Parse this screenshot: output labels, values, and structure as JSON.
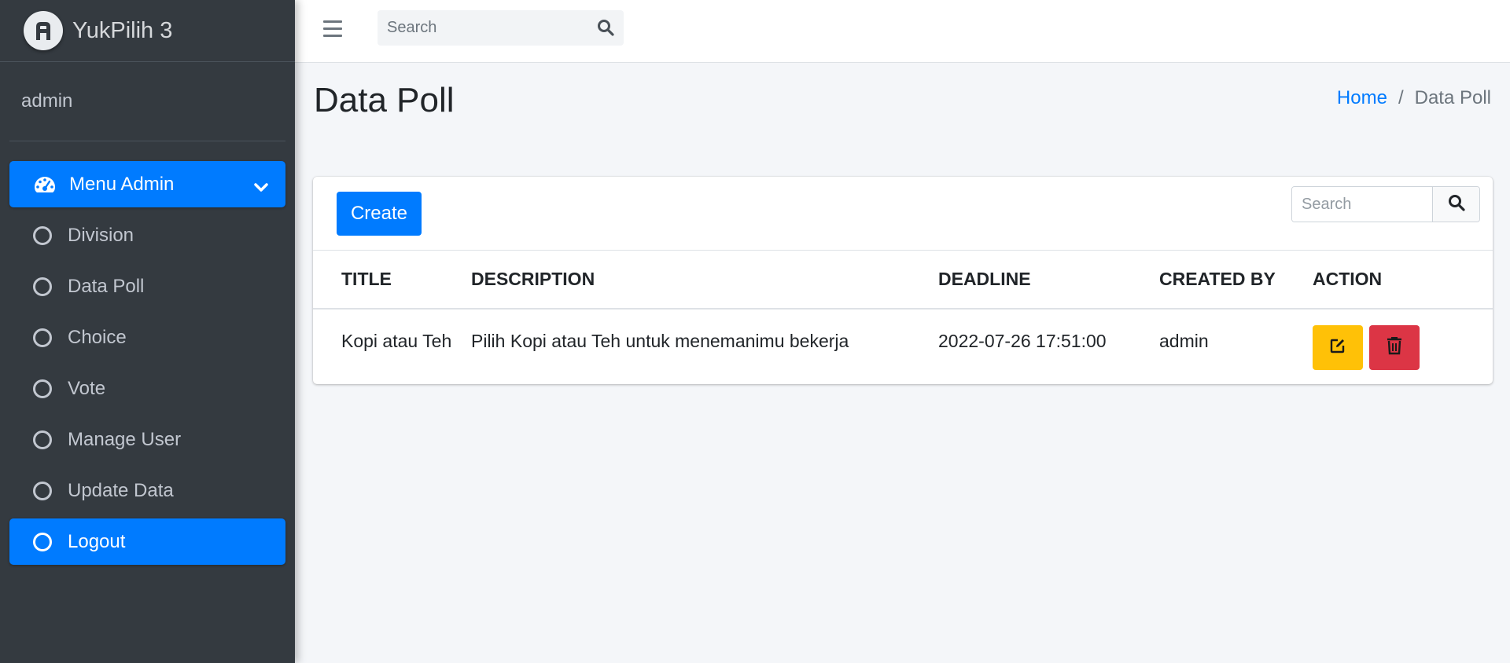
{
  "brand": {
    "name": "YukPilih 3"
  },
  "user": {
    "name": "admin"
  },
  "sidebar": {
    "menu_header": "Menu Admin",
    "items": [
      {
        "label": "Division"
      },
      {
        "label": "Data Poll"
      },
      {
        "label": "Choice"
      },
      {
        "label": "Vote"
      },
      {
        "label": "Manage User"
      },
      {
        "label": "Update Data"
      },
      {
        "label": "Logout"
      }
    ]
  },
  "topbar": {
    "search_placeholder": "Search"
  },
  "page": {
    "title": "Data Poll"
  },
  "breadcrumb": {
    "home": "Home",
    "separator": "/",
    "current": "Data Poll"
  },
  "card": {
    "create_label": "Create",
    "search_placeholder": "Search"
  },
  "table": {
    "headers": [
      "TITLE",
      "DESCRIPTION",
      "DEADLINE",
      "CREATED BY",
      "ACTION"
    ],
    "rows": [
      {
        "title": "Kopi atau Teh",
        "description": "Pilih Kopi atau Teh untuk menemanimu bekerja",
        "deadline": "2022-07-26 17:51:00",
        "created_by": "admin"
      }
    ]
  },
  "colors": {
    "primary": "#007bff",
    "sidebar_bg": "#343a40",
    "warning": "#ffc107",
    "danger": "#dc3545"
  }
}
